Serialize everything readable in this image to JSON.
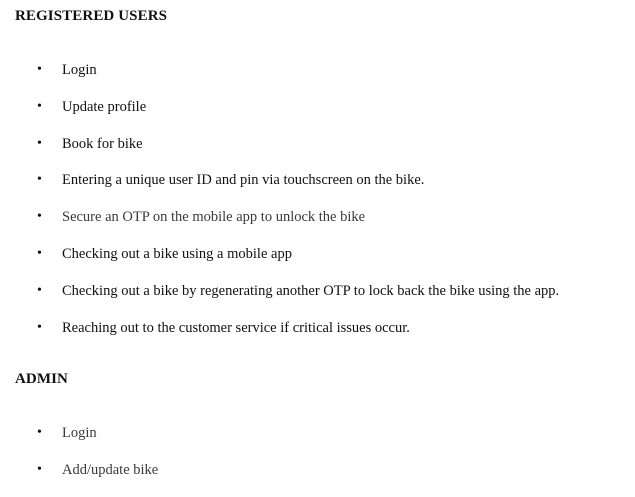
{
  "sections": [
    {
      "title": "REGISTERED USERS",
      "items": [
        "Login",
        "Update profile",
        "Book for bike",
        "Entering a unique user ID and pin via touchscreen on the bike.",
        "Secure an OTP on the mobile app to unlock the bike",
        "Checking out a bike using a mobile app",
        "Checking out a bike by regenerating another OTP to lock back the bike using the app.",
        "Reaching out to the customer service if critical issues occur."
      ]
    },
    {
      "title": "ADMIN",
      "items": [
        "Login",
        "Add/update bike"
      ]
    }
  ],
  "bullet_glyph": "•"
}
